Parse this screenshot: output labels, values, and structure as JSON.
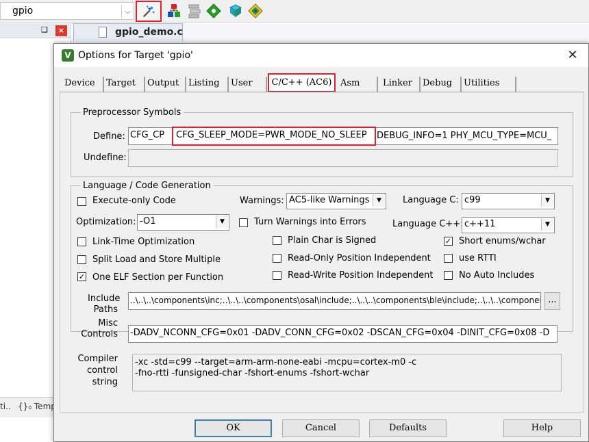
{
  "toolbar": {
    "target_name": "gpio",
    "icons": [
      "options-for-target-icon",
      "manage-components-icon",
      "file-extensions-icon",
      "pack-installer-icon",
      "select-software-packs-icon",
      "manage-run-time-environment-icon"
    ]
  },
  "project_panel": {
    "pin": "❑",
    "close": "×",
    "tab1": "ti..",
    "tab2": "{}₀ Temp"
  },
  "editor": {
    "tab_label": "gpio_demo.c"
  },
  "dialog": {
    "title": "Options for Target 'gpio'",
    "close": "✕",
    "tabs": [
      "Device",
      "Target",
      "Output",
      "Listing",
      "User",
      "C/C++ (AC6)",
      "Asm",
      "Linker",
      "Debug",
      "Utilities"
    ],
    "active_tab": "C/C++ (AC6)",
    "preprocessor": {
      "title": "Preprocessor Symbols",
      "define_label": "Define:",
      "define_part1": "CFG_CP",
      "define_part2": "CFG_SLEEP_MODE=PWR_MODE_NO_SLEEP",
      "define_part3": "DEBUG_INFO=1 PHY_MCU_TYPE=MCU_",
      "undefine_label": "Undefine:",
      "undefine_value": ""
    },
    "language": {
      "title": "Language / Code Generation",
      "execute_only": {
        "label": "Execute-only Code",
        "checked": false
      },
      "warnings_label": "Warnings:",
      "warnings_value": "AC5-like Warnings",
      "language_c_label": "Language C:",
      "language_c_value": "c99",
      "optimization_label": "Optimization:",
      "optimization_value": "-O1",
      "turn_warnings": {
        "label": "Turn Warnings into Errors",
        "checked": false
      },
      "language_cpp_label": "Language C++:",
      "language_cpp_value": "c++11",
      "link_time": {
        "label": "Link-Time Optimization",
        "checked": false
      },
      "plain_char": {
        "label": "Plain Char is Signed",
        "checked": false
      },
      "short_enums": {
        "label": "Short enums/wchar",
        "checked": true
      },
      "split_load": {
        "label": "Split Load and Store Multiple",
        "checked": false
      },
      "ro_pi": {
        "label": "Read-Only Position Independent",
        "checked": false
      },
      "use_rtti": {
        "label": "use RTTI",
        "checked": false
      },
      "one_elf": {
        "label": "One ELF Section per Function",
        "checked": true
      },
      "rw_pi": {
        "label": "Read-Write Position Independent",
        "checked": false
      },
      "no_auto_includes": {
        "label": "No Auto Includes",
        "checked": false
      }
    },
    "include_paths": {
      "label_line1": "Include",
      "label_line2": "Paths",
      "value": "..\\..\\..\\components\\inc;..\\..\\..\\components\\osal\\include;..\\..\\..\\components\\ble\\include;..\\..\\..\\components",
      "browse": "..."
    },
    "misc_controls": {
      "label_line1": "Misc",
      "label_line2": "Controls",
      "value": "-DADV_NCONN_CFG=0x01  -DADV_CONN_CFG=0x02  -DSCAN_CFG=0x04   -DINIT_CFG=0x08  -D"
    },
    "compiler_control": {
      "label_line1": "Compiler",
      "label_line2": "control",
      "label_line3": "string",
      "line1": "-xc -std=c99 --target=arm-arm-none-eabi -mcpu=cortex-m0 -c",
      "line2": "-fno-rtti -funsigned-char -fshort-enums -fshort-wchar"
    },
    "buttons": {
      "ok": "OK",
      "cancel": "Cancel",
      "defaults": "Defaults",
      "help": "Help"
    }
  },
  "colors": {
    "highlight": "#e0202a",
    "dialog_bg": "#f0f0f0"
  }
}
